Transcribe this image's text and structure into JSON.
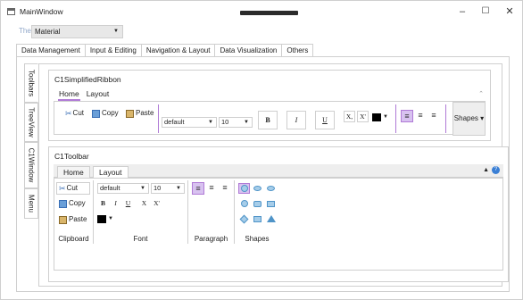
{
  "window": {
    "title": "MainWindow",
    "minimize": "–",
    "maximize": "☐",
    "close": "✕"
  },
  "theme": {
    "label": "Theme",
    "value": "Material"
  },
  "tabs": [
    {
      "label": "Data Management"
    },
    {
      "label": "Input & Editing"
    },
    {
      "label": "Navigation & Layout"
    },
    {
      "label": "Data Visualization"
    },
    {
      "label": "Others"
    }
  ],
  "side_tabs": [
    {
      "label": "Toolbars"
    },
    {
      "label": "TreeView"
    },
    {
      "label": "C1Window"
    },
    {
      "label": "Menu"
    }
  ],
  "ribbon": {
    "title": "C1SimplifiedRibbon",
    "tabs": [
      "Home",
      "Layout"
    ],
    "cut": "Cut",
    "copy": "Copy",
    "paste": "Paste",
    "font_family": "default",
    "font_size": "10",
    "bold": "B",
    "italic": "I",
    "underline": "U",
    "subscript": "X,",
    "superscript": "X'",
    "shapes": "Shapes"
  },
  "toolbar": {
    "title": "C1Toolbar",
    "tabs": [
      "Home",
      "Layout"
    ],
    "cut": "Cut",
    "copy": "Copy",
    "paste": "Paste",
    "font_family": "default",
    "font_size": "10",
    "bold": "B",
    "italic": "I",
    "underline": "U",
    "subscript": "X",
    "superscript": "X'",
    "groups": [
      "Clipboard",
      "Font",
      "Paragraph",
      "Shapes"
    ]
  },
  "colors": {
    "accent": "#b07ad6",
    "highlight": "#d8c2f0",
    "help": "#3a7fd5"
  }
}
